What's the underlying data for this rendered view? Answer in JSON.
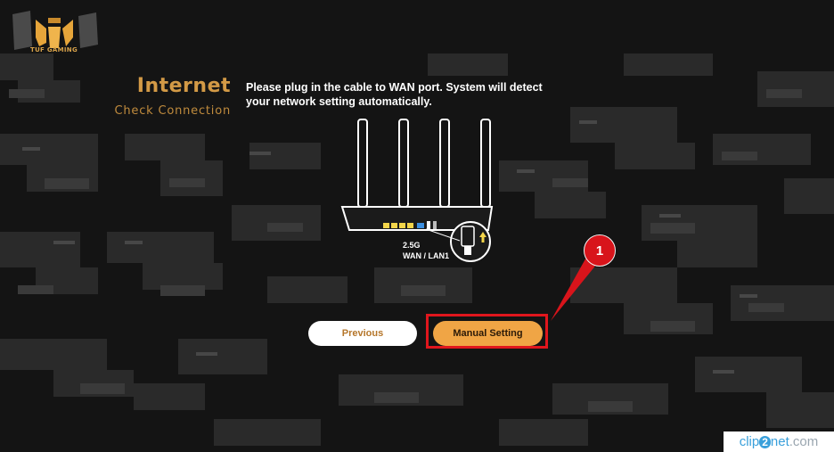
{
  "brand": {
    "logo_text": "TUF GAMING"
  },
  "header": {
    "title": "Internet",
    "subtitle": "Check Connection"
  },
  "instruction": "Please plug in the cable to WAN port. System will detect your network setting automatically.",
  "router_illustration": {
    "port_label_line1": "2.5G",
    "port_label_line2": "WAN / LAN1"
  },
  "buttons": {
    "previous": "Previous",
    "manual_setting": "Manual Setting"
  },
  "annotation": {
    "step_number": "1"
  },
  "watermark": {
    "part1": "clip",
    "part2": "2",
    "part3": "net",
    "part4": ".com"
  },
  "colors": {
    "accent": "#f0a545",
    "title_gold": "#d39a46",
    "callout_red": "#e0161d",
    "background": "#141414"
  }
}
